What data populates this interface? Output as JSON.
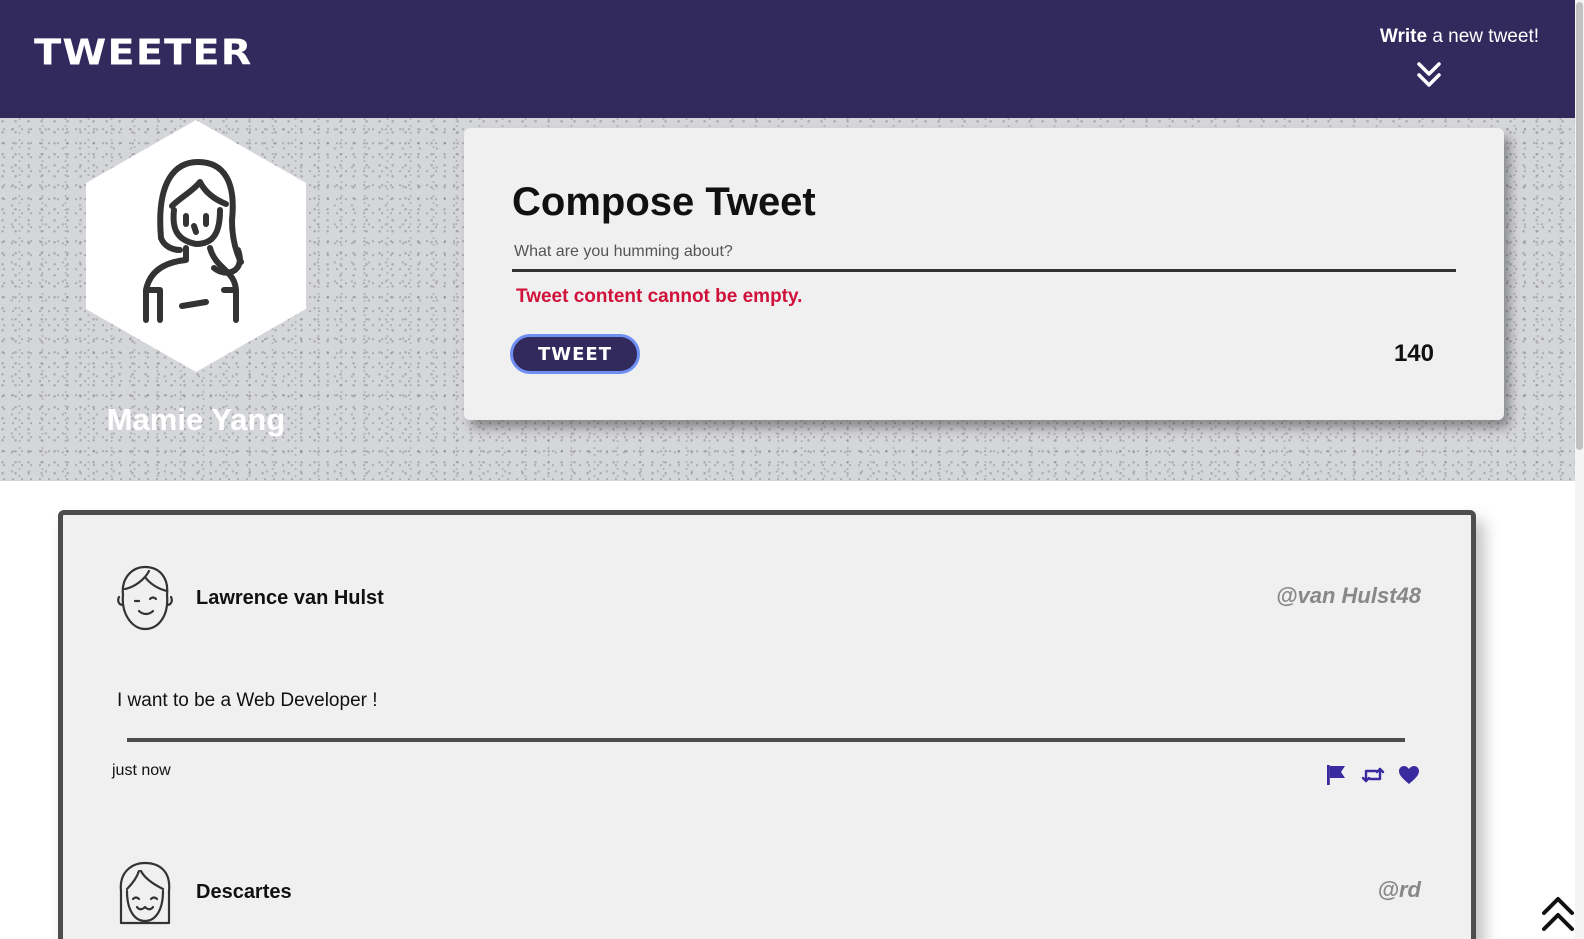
{
  "nav": {
    "logo": "TWEETER",
    "write_new_bold": "Write",
    "write_new_rest": " a new tweet!",
    "write_new_icon": "double-chevron-down-icon"
  },
  "profile": {
    "name": "Mamie Yang",
    "avatar_icon": "woman-avatar-icon"
  },
  "compose": {
    "title": "Compose Tweet",
    "placeholder": "What are you humming about?",
    "value": "",
    "error": "Tweet content cannot be empty.",
    "button_label": "TWEET",
    "counter": "140"
  },
  "tweets": [
    {
      "name": "Lawrence van Hulst",
      "handle": "@van Hulst48",
      "body": "I want to be a Web Developer !",
      "time": "just now",
      "avatar_icon": "man-avatar-icon"
    },
    {
      "name": "Descartes",
      "handle": "@rd",
      "avatar_icon": "girl-avatar-icon"
    }
  ],
  "actions": [
    "flag-icon",
    "retweet-icon",
    "heart-icon"
  ],
  "colors": {
    "nav_bg": "#32295d",
    "accent": "#32295d",
    "error": "#d0113a",
    "action_icon": "#3a2aa0",
    "button_focus_ring": "#6f8ff3"
  },
  "scroll_top_icon": "double-chevron-up-icon"
}
